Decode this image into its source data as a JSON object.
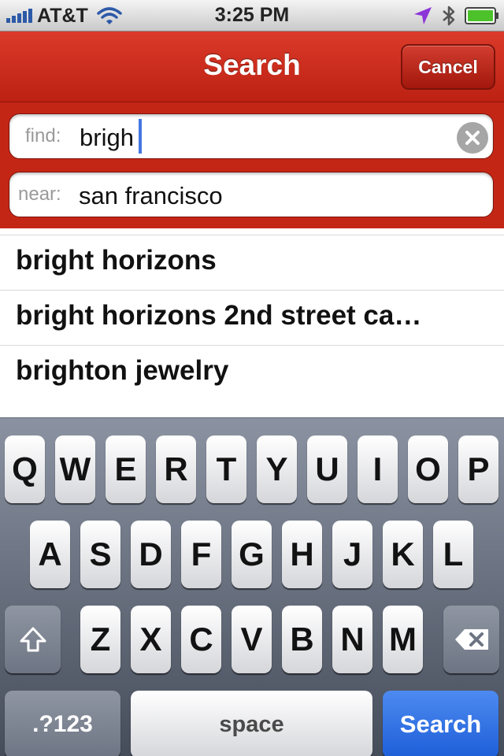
{
  "status_bar": {
    "carrier": "AT&T",
    "time": "3:25 PM",
    "icons": [
      "signal-icon",
      "wifi-icon",
      "location-icon",
      "bluetooth-icon",
      "battery-icon"
    ]
  },
  "header": {
    "title": "Search",
    "cancel_label": "Cancel",
    "accent_color": "#c42616"
  },
  "search": {
    "find_label": "find:",
    "find_value": "brigh",
    "near_label": "near:",
    "near_value": "san francisco"
  },
  "suggestions": [
    "bright horizons",
    "bright horizons 2nd street ca…",
    "brighton jewelry"
  ],
  "keyboard": {
    "row1": [
      "Q",
      "W",
      "E",
      "R",
      "T",
      "Y",
      "U",
      "I",
      "O",
      "P"
    ],
    "row2": [
      "A",
      "S",
      "D",
      "F",
      "G",
      "H",
      "J",
      "K",
      "L"
    ],
    "row3": [
      "Z",
      "X",
      "C",
      "V",
      "B",
      "N",
      "M"
    ],
    "numbers_label": ".?123",
    "space_label": "space",
    "go_label": "Search",
    "go_color": "#2266dd"
  }
}
